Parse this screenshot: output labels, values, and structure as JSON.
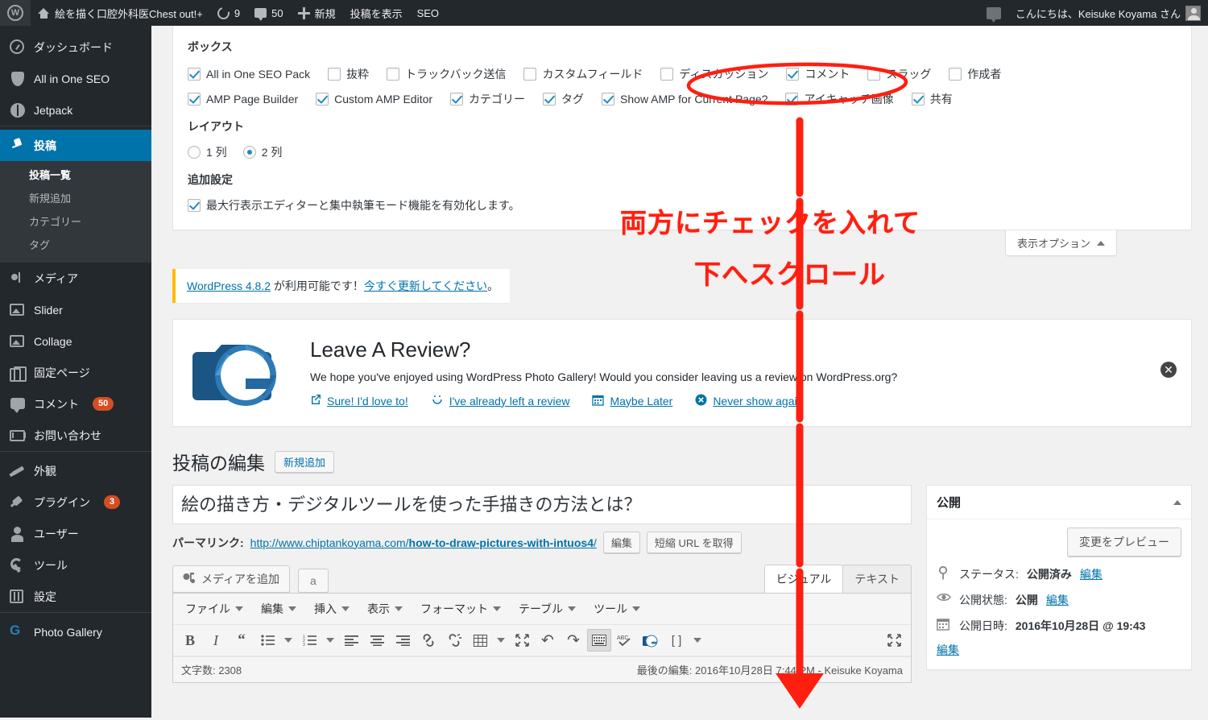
{
  "adminbar": {
    "site_title": "絵を描く口腔外科医Chest out!+",
    "updates_count": "9",
    "comments_count": "50",
    "new_label": "新規",
    "view_post_label": "投稿を表示",
    "seo_label": "SEO",
    "howdy": "こんにちは、Keisuke Koyama さん"
  },
  "sidebar": {
    "items": [
      {
        "label": "ダッシュボード",
        "icon": "dashboard-icon"
      },
      {
        "label": "All in One SEO",
        "icon": "shield-icon"
      },
      {
        "label": "Jetpack",
        "icon": "jetpack-icon"
      },
      {
        "label": "投稿",
        "icon": "pin-icon",
        "current": true
      },
      {
        "label": "メディア",
        "icon": "media-icon"
      },
      {
        "label": "Slider",
        "icon": "image-icon"
      },
      {
        "label": "Collage",
        "icon": "image-icon"
      },
      {
        "label": "固定ページ",
        "icon": "page-icon"
      },
      {
        "label": "コメント",
        "icon": "comment-icon",
        "badge": "50"
      },
      {
        "label": "お問い合わせ",
        "icon": "mail-icon"
      },
      {
        "label": "外観",
        "icon": "brush-icon"
      },
      {
        "label": "プラグイン",
        "icon": "plug-icon",
        "badge": "3"
      },
      {
        "label": "ユーザー",
        "icon": "user-icon"
      },
      {
        "label": "ツール",
        "icon": "wrench-icon"
      },
      {
        "label": "設定",
        "icon": "settings-icon"
      },
      {
        "label": "Photo Gallery",
        "icon": "photo-gallery-icon"
      }
    ],
    "submenu": [
      {
        "label": "投稿一覧",
        "current": true
      },
      {
        "label": "新規追加"
      },
      {
        "label": "カテゴリー"
      },
      {
        "label": "タグ"
      }
    ]
  },
  "screen_options": {
    "boxes_heading": "ボックス",
    "boxes_row1": [
      {
        "label": "All in One SEO Pack",
        "checked": true
      },
      {
        "label": "抜粋",
        "checked": false
      },
      {
        "label": "トラックバック送信",
        "checked": false
      },
      {
        "label": "カスタムフィールド",
        "checked": false
      },
      {
        "label": "ディスカッション",
        "checked": false
      },
      {
        "label": "コメント",
        "checked": true
      },
      {
        "label": "スラッグ",
        "checked": false
      },
      {
        "label": "作成者",
        "checked": false
      }
    ],
    "boxes_row2": [
      {
        "label": "AMP Page Builder",
        "checked": true
      },
      {
        "label": "Custom AMP Editor",
        "checked": true
      },
      {
        "label": "カテゴリー",
        "checked": true
      },
      {
        "label": "タグ",
        "checked": true
      },
      {
        "label": "Show AMP for Current Page?",
        "checked": true
      },
      {
        "label": "アイキャッチ画像",
        "checked": true
      },
      {
        "label": "共有",
        "checked": true
      }
    ],
    "layout_heading": "レイアウト",
    "layout_options": [
      {
        "label": "1 列",
        "selected": false
      },
      {
        "label": "2 列",
        "selected": true
      }
    ],
    "extra_heading": "追加設定",
    "extra_option": {
      "label": "最大行表示エディターと集中執筆モード機能を有効化します。",
      "checked": true
    },
    "toggle_label": "表示オプション"
  },
  "update_nag": {
    "link_version": "WordPress 4.8.2",
    "middle": " が利用可能です！",
    "link_update": "今すぐ更新してください",
    "tail": "。"
  },
  "review_notice": {
    "title": "Leave A Review?",
    "description": "We hope you've enjoyed using WordPress Photo Gallery! Would you consider leaving us a review on WordPress.org?",
    "links": [
      {
        "label": "Sure! I'd love to!",
        "icon": "external-link-icon"
      },
      {
        "label": "I've already left a review",
        "icon": "smiley-icon"
      },
      {
        "label": "Maybe Later",
        "icon": "calendar-icon"
      },
      {
        "label": "Never show again",
        "icon": "circle-x-icon"
      }
    ]
  },
  "post_edit": {
    "page_title": "投稿の編集",
    "add_new_label": "新規追加",
    "title_value": "絵の描き方・デジタルツールを使った手描きの方法とは？",
    "permalink_label": "パーマリンク:",
    "permalink_prefix": "http://www.chiptankoyama.com/",
    "permalink_slug": "how-to-draw-pictures-with-intuos4",
    "permalink_suffix": "/",
    "edit_button": "編集",
    "shortlink_button": "短縮 URL を取得",
    "add_media_label": "メディアを追加",
    "amazon_label": "a",
    "tabs": [
      {
        "label": "ビジュアル",
        "active": true
      },
      {
        "label": "テキスト",
        "active": false
      }
    ],
    "menubar": [
      "ファイル",
      "編集",
      "挿入",
      "表示",
      "フォーマット",
      "テーブル",
      "ツール"
    ],
    "toolbar_icons": [
      "bold-icon",
      "italic-icon",
      "blockquote-icon",
      "bullet-list-icon",
      "chevron-down-icon",
      "numbered-list-icon",
      "chevron-down-icon",
      "align-left-icon",
      "align-center-icon",
      "align-right-icon",
      "link-icon",
      "unlink-icon",
      "table-icon",
      "chevron-down-icon",
      "fullscreen-icon",
      "undo-icon",
      "redo-icon",
      "keyboard-icon",
      "spellcheck-icon",
      "photo-gallery-icon",
      "shortcode-icon",
      "chevron-down-icon",
      "distraction-free-icon"
    ],
    "word_count_label": "文字数: 2308",
    "last_edited": "最後の編集: 2016年10月28日 7:44 PM - Keisuke Koyama"
  },
  "publish_box": {
    "heading": "公開",
    "preview_button": "変更をプレビュー",
    "status_label": "ステータス:",
    "status_value": "公開済み",
    "status_edit": "編集",
    "visibility_label": "公開状態:",
    "visibility_value": "公開",
    "visibility_edit": "編集",
    "date_label": "公開日時:",
    "date_value": "2016年10月28日 @ 19:43",
    "date_edit": "編集"
  },
  "annotation": {
    "line1": "両方にチェックを入れて",
    "line2": "下へスクロール",
    "color": "#ff1f10"
  }
}
